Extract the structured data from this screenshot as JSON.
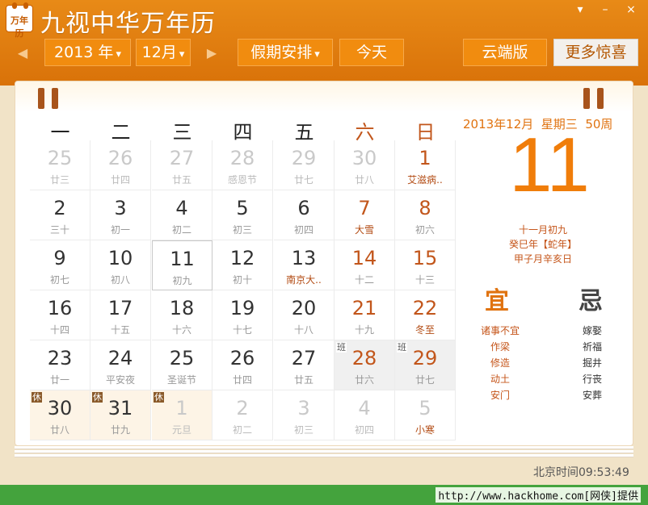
{
  "app": {
    "icon_text": "万年历",
    "title": "九视中华万年历",
    "window_controls": [
      "▾",
      "–",
      "×"
    ]
  },
  "toolbar": {
    "prev": "◀",
    "next": "▶",
    "year": "2013 年",
    "month": "12月",
    "holiday": "假期安排",
    "today": "今天",
    "cloud": "云端版",
    "more": "更多惊喜",
    "caret": "▾"
  },
  "weekdays": [
    "一",
    "二",
    "三",
    "四",
    "五",
    "六",
    "日"
  ],
  "calendar": {
    "weeks": [
      [
        {
          "d": "25",
          "l": "廿三",
          "type": "other"
        },
        {
          "d": "26",
          "l": "廿四",
          "type": "other"
        },
        {
          "d": "27",
          "l": "廿五",
          "type": "other"
        },
        {
          "d": "28",
          "l": "感恩节",
          "type": "other"
        },
        {
          "d": "29",
          "l": "廿七",
          "type": "other"
        },
        {
          "d": "30",
          "l": "廿八",
          "type": "other"
        },
        {
          "d": "1",
          "l": "艾滋病..",
          "type": "fest"
        }
      ],
      [
        {
          "d": "2",
          "l": "三十",
          "type": ""
        },
        {
          "d": "3",
          "l": "初一",
          "type": ""
        },
        {
          "d": "4",
          "l": "初二",
          "type": ""
        },
        {
          "d": "5",
          "l": "初三",
          "type": ""
        },
        {
          "d": "6",
          "l": "初四",
          "type": ""
        },
        {
          "d": "7",
          "l": "大雪",
          "type": "fest"
        },
        {
          "d": "8",
          "l": "初六",
          "type": ""
        }
      ],
      [
        {
          "d": "9",
          "l": "初七",
          "type": ""
        },
        {
          "d": "10",
          "l": "初八",
          "type": ""
        },
        {
          "d": "11",
          "l": "初九",
          "type": "today"
        },
        {
          "d": "12",
          "l": "初十",
          "type": ""
        },
        {
          "d": "13",
          "l": "南京大..",
          "type": "fest"
        },
        {
          "d": "14",
          "l": "十二",
          "type": ""
        },
        {
          "d": "15",
          "l": "十三",
          "type": ""
        }
      ],
      [
        {
          "d": "16",
          "l": "十四",
          "type": ""
        },
        {
          "d": "17",
          "l": "十五",
          "type": ""
        },
        {
          "d": "18",
          "l": "十六",
          "type": ""
        },
        {
          "d": "19",
          "l": "十七",
          "type": ""
        },
        {
          "d": "20",
          "l": "十八",
          "type": ""
        },
        {
          "d": "21",
          "l": "十九",
          "type": ""
        },
        {
          "d": "22",
          "l": "冬至",
          "type": "fest"
        }
      ],
      [
        {
          "d": "23",
          "l": "廿一",
          "type": ""
        },
        {
          "d": "24",
          "l": "平安夜",
          "type": ""
        },
        {
          "d": "25",
          "l": "圣诞节",
          "type": ""
        },
        {
          "d": "26",
          "l": "廿四",
          "type": ""
        },
        {
          "d": "27",
          "l": "廿五",
          "type": ""
        },
        {
          "d": "28",
          "l": "廿六",
          "type": "workday",
          "tag": "班"
        },
        {
          "d": "29",
          "l": "廿七",
          "type": "workday",
          "tag": "班"
        }
      ],
      [
        {
          "d": "30",
          "l": "廿八",
          "type": "holiday",
          "tag": "休"
        },
        {
          "d": "31",
          "l": "廿九",
          "type": "holiday",
          "tag": "休"
        },
        {
          "d": "1",
          "l": "元旦",
          "type": "holiday other",
          "tag": "休"
        },
        {
          "d": "2",
          "l": "初二",
          "type": "other"
        },
        {
          "d": "3",
          "l": "初三",
          "type": "other"
        },
        {
          "d": "4",
          "l": "初四",
          "type": "other"
        },
        {
          "d": "5",
          "l": "小寒",
          "type": "other fest"
        }
      ]
    ]
  },
  "detail": {
    "dateline": "2013年12月  星期三  50周",
    "day": "11",
    "lunar_lines": [
      "十一月初九",
      "癸巳年【蛇年】",
      "甲子月辛亥日"
    ],
    "yi_title": "宜",
    "ji_title": "忌",
    "yi": [
      "诸事不宜",
      "作梁",
      "修造",
      "动土",
      "安门"
    ],
    "ji": [
      "嫁娶",
      "祈福",
      "掘井",
      "行丧",
      "安葬"
    ]
  },
  "clock": "北京时间09:53:49",
  "footer": "http://www.hackhome.com[网侠]提供",
  "colors": {
    "accent": "#f07d0a",
    "header": "#e07a0c",
    "footer_bar": "#44a33d"
  }
}
